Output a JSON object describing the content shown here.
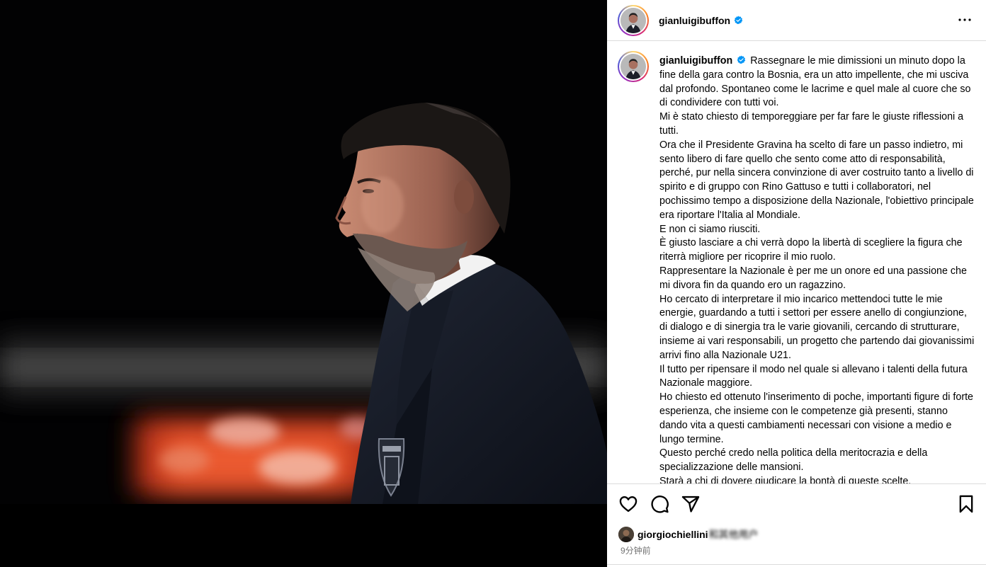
{
  "post": {
    "username": "gianluigibuffon",
    "verified": true,
    "caption_paragraphs": [
      "Rassegnare le mie dimissioni un minuto dopo la fine della gara contro la Bosnia, era un atto impellente, che mi usciva dal profondo. Spontaneo come le lacrime e quel male al cuore che so di condividere con tutti voi.",
      "Mi è stato chiesto di temporeggiare per far fare le giuste riflessioni a tutti.",
      "Ora che il Presidente Gravina ha scelto di fare un passo indietro, mi sento libero di fare quello che sento come atto di responsabilità, perché, pur nella sincera convinzione di aver costruito tanto a livello di spirito e di gruppo con Rino Gattuso e tutti i collaboratori, nel pochissimo tempo a disposizione della Nazionale, l'obiettivo principale era riportare l'Italia al Mondiale.",
      "E non ci siamo riusciti.",
      "È giusto lasciare a chi verrà dopo la libertà di scegliere la figura che riterrà migliore per ricoprire il mio ruolo.",
      "Rappresentare la Nazionale è per me un onore ed una passione che mi divora fin da quando ero un ragazzino.",
      "Ho cercato di interpretare il mio incarico mettendoci tutte le mie energie, guardando a tutti i settori per essere anello di congiunzione, di dialogo e di sinergia tra le varie giovanili, cercando di strutturare, insieme ai vari responsabili, un progetto che partendo dai giovanissimi arrivi fino alla Nazionale U21.",
      "Il tutto per ripensare il modo nel quale si allevano i talenti della futura Nazionale maggiore.",
      "Ho chiesto ed ottenuto l'inserimento di poche, importanti figure di forte esperienza, che insieme con le competenze già presenti, stanno dando vita a questi cambiamenti necessari con visione a medio e lungo termine.",
      "Questo perché credo nella politica della meritocrazia e della specializzazione delle mansioni.",
      "Starà a chi di dovere giudicare la bontà di queste scelte."
    ],
    "liked_by": "giorgiochiellini",
    "liked_by_suffix": "和其他用户",
    "timestamp": "9分钟前"
  },
  "icons": {
    "more": "more-icon",
    "like": "heart-icon",
    "comment": "comment-icon",
    "share": "share-icon",
    "save": "bookmark-icon",
    "verified": "verified-badge-icon"
  },
  "colors": {
    "verified_blue": "#0095f6",
    "border": "#dbdbdb",
    "secondary_text": "#737373"
  }
}
